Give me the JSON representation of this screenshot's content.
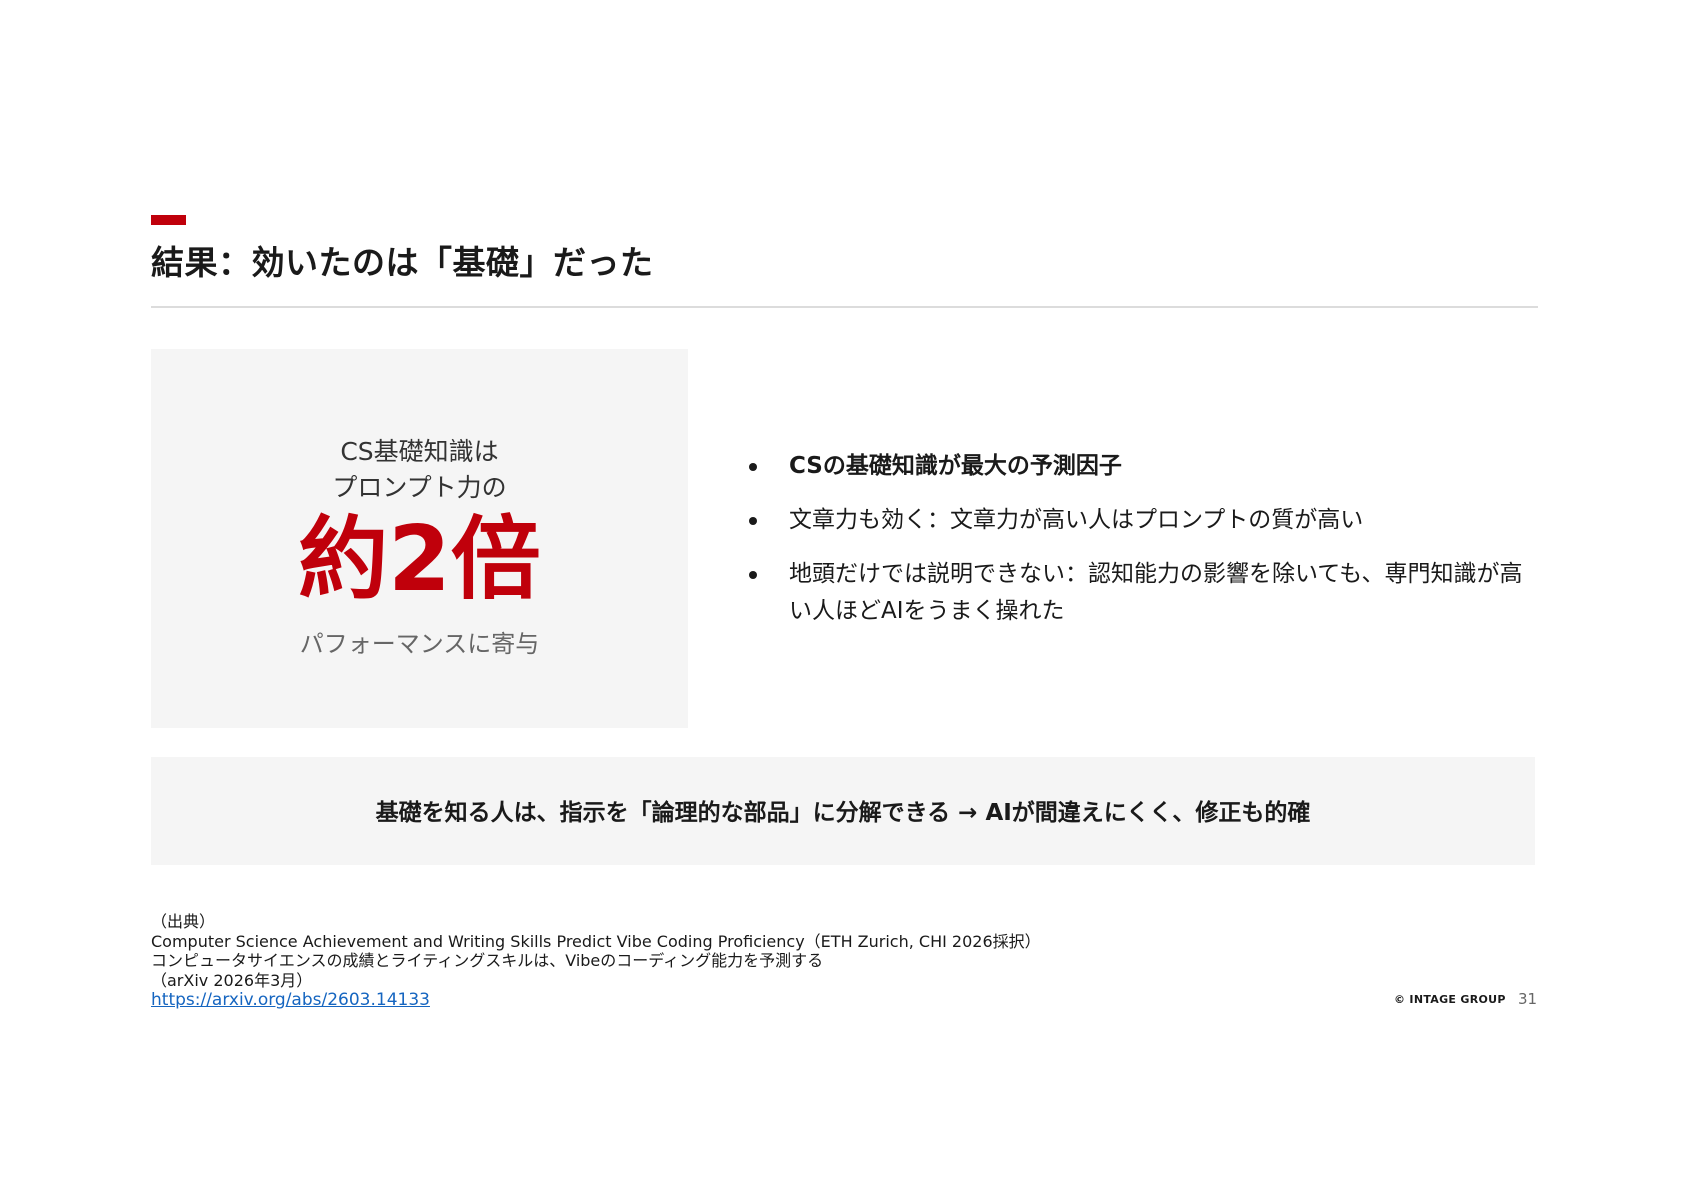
{
  "slide": {
    "title": "結果：効いたのは「基礎」だった",
    "accent_color": "#c0000b"
  },
  "highlight": {
    "line1": "CS基礎知識は",
    "line2": "プロンプト力の",
    "big": "約2倍",
    "line4": "パフォーマンスに寄与"
  },
  "bullets": [
    "CSの基礎知識が最大の予測因子",
    "文章力も効く：文章力が高い人はプロンプトの質が高い",
    "地頭だけでは説明できない：認知能力の影響を除いても、専門知識が高い人ほどAIをうまく操れた"
  ],
  "conclusion": "基礎を知る人は、指示を「論理的な部品」に分解できる → AIが間違えにくく、修正も的確",
  "source": {
    "heading": "（出典）",
    "line1": "Computer Science Achievement and Writing Skills Predict Vibe Coding Proficiency（ETH Zurich, CHI 2026採択）",
    "line2": "コンピュータサイエンスの成績とライティングスキルは、Vibeのコーディング能力を予測する",
    "line3": "（arXiv 2026年3月）",
    "link": "https://arxiv.org/abs/2603.14133"
  },
  "footer": {
    "brand": "© INTAGE GROUP",
    "page": "31"
  }
}
